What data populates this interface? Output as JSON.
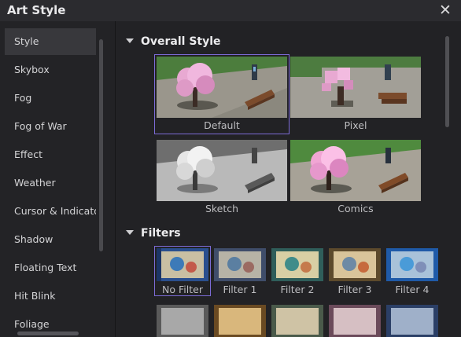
{
  "window": {
    "title": "Art Style",
    "close_icon": "close-icon"
  },
  "sidebar": {
    "items": [
      {
        "label": "Style",
        "active": true
      },
      {
        "label": "Skybox"
      },
      {
        "label": "Fog"
      },
      {
        "label": "Fog of War"
      },
      {
        "label": "Effect"
      },
      {
        "label": "Weather"
      },
      {
        "label": "Cursor & Indicato"
      },
      {
        "label": "Shadow"
      },
      {
        "label": "Floating Text"
      },
      {
        "label": "Hit Blink"
      },
      {
        "label": "Foliage"
      }
    ]
  },
  "sections": {
    "overall": {
      "title": "Overall Style",
      "cards": [
        {
          "label": "Default",
          "selected": true
        },
        {
          "label": "Pixel"
        },
        {
          "label": "Sketch"
        },
        {
          "label": "Comics"
        }
      ]
    },
    "filters": {
      "title": "Filters",
      "cards": [
        {
          "label": "No Filter",
          "selected": true
        },
        {
          "label": "Filter 1"
        },
        {
          "label": "Filter 2"
        },
        {
          "label": "Filter 3"
        },
        {
          "label": "Filter 4"
        }
      ]
    }
  },
  "colors": {
    "accent": "#7c6bd6",
    "background": "#222225",
    "sidebar_active": "#38383c"
  }
}
